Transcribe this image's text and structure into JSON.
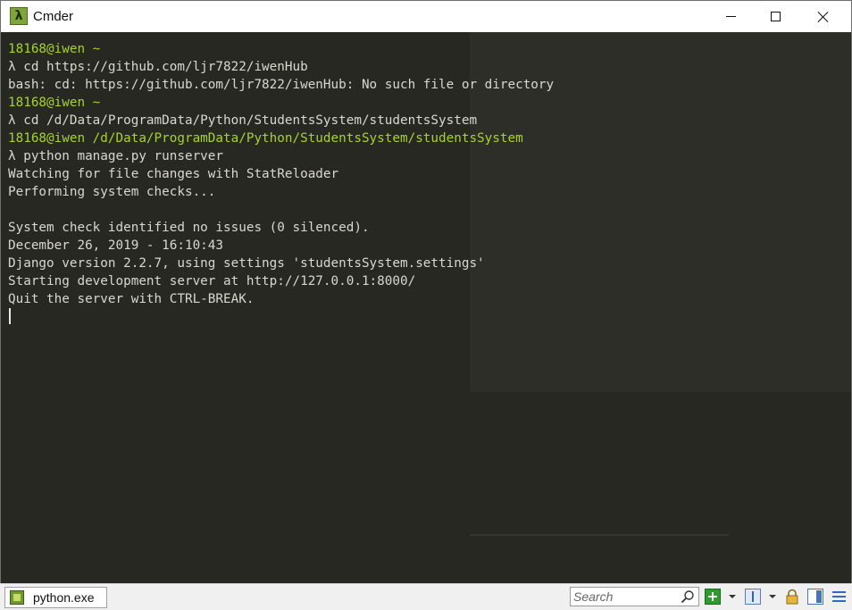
{
  "window": {
    "title": "Cmder",
    "app_icon_glyph": "λ",
    "controls": [
      "minimize",
      "maximize",
      "close"
    ]
  },
  "terminal": {
    "colors": {
      "background": "#272822",
      "prompt": "#a6d22e",
      "text": "#d8d8d0"
    },
    "lines": [
      {
        "text": "18168@iwen ~",
        "style": "prompt"
      },
      {
        "text": "λ cd https://github.com/ljr7822/iwenHub",
        "style": "normal"
      },
      {
        "text": "bash: cd: https://github.com/ljr7822/iwenHub: No such file or directory",
        "style": "normal"
      },
      {
        "text": "18168@iwen ~",
        "style": "prompt"
      },
      {
        "text": "λ cd /d/Data/ProgramData/Python/StudentsSystem/studentsSystem",
        "style": "normal"
      },
      {
        "text": "18168@iwen /d/Data/ProgramData/Python/StudentsSystem/studentsSystem",
        "style": "prompt"
      },
      {
        "text": "λ python manage.py runserver",
        "style": "normal"
      },
      {
        "text": "Watching for file changes with StatReloader",
        "style": "normal"
      },
      {
        "text": "Performing system checks...",
        "style": "normal"
      },
      {
        "text": "",
        "style": "normal"
      },
      {
        "text": "System check identified no issues (0 silenced).",
        "style": "normal"
      },
      {
        "text": "December 26, 2019 - 16:10:43",
        "style": "normal"
      },
      {
        "text": "Django version 2.2.7, using settings 'studentsSystem.settings'",
        "style": "normal"
      },
      {
        "text": "Starting development server at http://127.0.0.1:8000/",
        "style": "normal"
      },
      {
        "text": "Quit the server with CTRL-BREAK.",
        "style": "normal"
      }
    ]
  },
  "statusbar": {
    "tab_label": "python.exe",
    "search_placeholder": "Search",
    "icons": [
      "add-console-icon",
      "split-console-icon",
      "lock-icon",
      "panel-icon",
      "menu-icon"
    ]
  }
}
